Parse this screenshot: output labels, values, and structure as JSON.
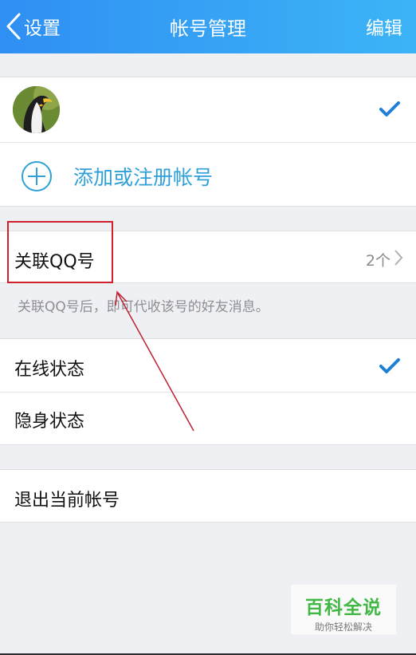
{
  "header": {
    "back_label": "设置",
    "title": "帐号管理",
    "edit_label": "编辑"
  },
  "accounts": {
    "add_label": "添加或注册帐号"
  },
  "linked_qq": {
    "label": "关联QQ号",
    "count": "2个",
    "note": "关联QQ号后，即可代收该号的好友消息。"
  },
  "status": {
    "online_label": "在线状态",
    "invisible_label": "隐身状态"
  },
  "logout": {
    "label": "退出当前帐号"
  },
  "watermark": {
    "title": "百科全说",
    "subtitle": "助你轻松解决"
  },
  "colors": {
    "header_start": "#2f8ff3",
    "header_end": "#3cb4f6",
    "accent": "#2fa0d8",
    "check": "#1e7fd4",
    "annotation": "#d0202a"
  },
  "icons": [
    "back-chevron-icon",
    "checkmark-icon",
    "add-circle-icon",
    "chevron-right-icon"
  ]
}
